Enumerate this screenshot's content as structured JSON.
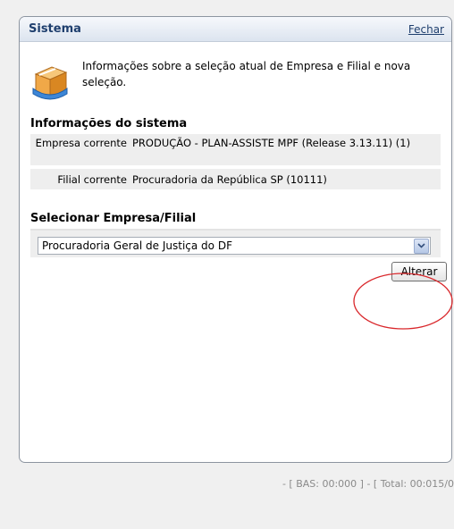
{
  "panel": {
    "title": "Sistema",
    "close_label": "Fechar",
    "intro_text": "Informações sobre a seleção atual de Empresa e Filial e  nova seleção."
  },
  "info_section": {
    "title": "Informações do sistema",
    "rows": [
      {
        "label": "Empresa corrente",
        "value": "PRODUÇÃO - PLAN-ASSISTE MPF (Release 3.13.11) (1)"
      },
      {
        "label": "Filial corrente",
        "value": "Procuradoria da República SP (10111)"
      }
    ]
  },
  "select_section": {
    "title": "Selecionar Empresa/Filial",
    "selected_value": "Procuradoria Geral de Justiça do DF",
    "button_label": "Alterar"
  },
  "footer": {
    "status": "- [ BAS: 00:000 ] - [ Total: 00:015/0"
  },
  "colors": {
    "header_text": "#1f3f6e",
    "highlight_circle": "#d9262a",
    "row_background": "#eeeeee"
  },
  "icons": {
    "intro": "package-box-icon",
    "dropdown": "chevron-down-icon"
  }
}
